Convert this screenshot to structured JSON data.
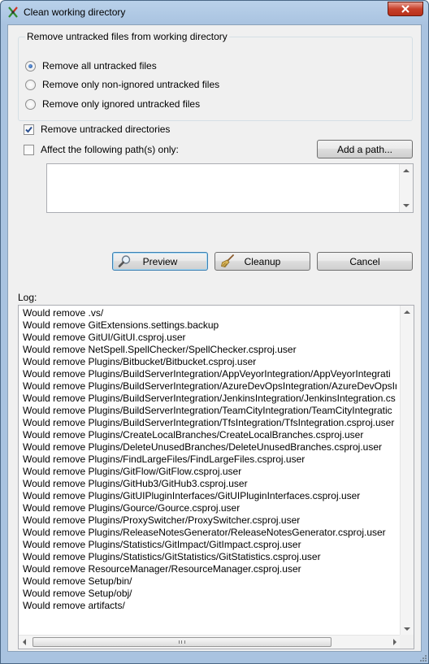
{
  "window": {
    "title": "Clean working directory"
  },
  "remove_untracked": {
    "legend": "Remove untracked files from working directory",
    "options": [
      {
        "label": "Remove all untracked files",
        "selected": true
      },
      {
        "label": "Remove only non-ignored untracked files",
        "selected": false
      },
      {
        "label": "Remove only ignored untracked files",
        "selected": false
      }
    ]
  },
  "options": {
    "remove_dirs_label": "Remove untracked directories",
    "remove_dirs_checked": true,
    "affect_paths_label": "Affect the following path(s) only:",
    "affect_paths_checked": false,
    "add_path_label": "Add a path...",
    "paths_value": ""
  },
  "actions": {
    "preview_label": "Preview",
    "cleanup_label": "Cleanup",
    "cancel_label": "Cancel"
  },
  "log": {
    "label": "Log:",
    "lines": [
      "Would remove .vs/",
      "Would remove GitExtensions.settings.backup",
      "Would remove GitUI/GitUI.csproj.user",
      "Would remove NetSpell.SpellChecker/SpellChecker.csproj.user",
      "Would remove Plugins/Bitbucket/Bitbucket.csproj.user",
      "Would remove Plugins/BuildServerIntegration/AppVeyorIntegration/AppVeyorIntegrati",
      "Would remove Plugins/BuildServerIntegration/AzureDevOpsIntegration/AzureDevOpsIn",
      "Would remove Plugins/BuildServerIntegration/JenkinsIntegration/JenkinsIntegration.cs",
      "Would remove Plugins/BuildServerIntegration/TeamCityIntegration/TeamCityIntegratic",
      "Would remove Plugins/BuildServerIntegration/TfsIntegration/TfsIntegration.csproj.user",
      "Would remove Plugins/CreateLocalBranches/CreateLocalBranches.csproj.user",
      "Would remove Plugins/DeleteUnusedBranches/DeleteUnusedBranches.csproj.user",
      "Would remove Plugins/FindLargeFiles/FindLargeFiles.csproj.user",
      "Would remove Plugins/GitFlow/GitFlow.csproj.user",
      "Would remove Plugins/GitHub3/GitHub3.csproj.user",
      "Would remove Plugins/GitUIPluginInterfaces/GitUIPluginInterfaces.csproj.user",
      "Would remove Plugins/Gource/Gource.csproj.user",
      "Would remove Plugins/ProxySwitcher/ProxySwitcher.csproj.user",
      "Would remove Plugins/ReleaseNotesGenerator/ReleaseNotesGenerator.csproj.user",
      "Would remove Plugins/Statistics/GitImpact/GitImpact.csproj.user",
      "Would remove Plugins/Statistics/GitStatistics/GitStatistics.csproj.user",
      "Would remove ResourceManager/ResourceManager.csproj.user",
      "Would remove Setup/bin/",
      "Would remove Setup/obj/",
      "Would remove artifacts/"
    ]
  }
}
